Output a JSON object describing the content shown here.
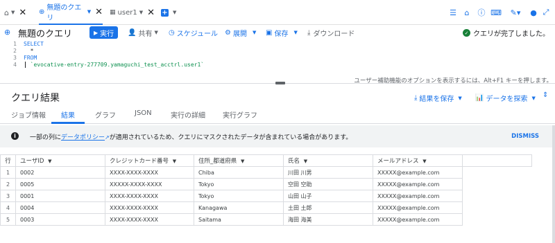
{
  "tabs": [
    {
      "label": "無題のクエリ",
      "active": true
    },
    {
      "label": "user1",
      "active": false
    }
  ],
  "query": {
    "title": "無題のクエリ",
    "run_label": "実行",
    "share_label": "共有",
    "schedule_label": "スケジュール",
    "deploy_label": "展開",
    "save_label": "保存",
    "download_label": "ダウンロード",
    "status": "クエリが完了しました。"
  },
  "editor": {
    "lines": [
      {
        "n": "1",
        "text": "SELECT"
      },
      {
        "n": "2",
        "text": "  *"
      },
      {
        "n": "3",
        "text": "FROM"
      },
      {
        "n": "4",
        "text": "  `evocative-entry-277709.yamaguchi_test_acctrl.user1`"
      }
    ],
    "a11y_hint": "ユーザー補助機能のオプションを表示するには、Alt+F1 キーを押します。"
  },
  "results": {
    "title": "クエリ結果",
    "save_results_label": "結果を保存",
    "explore_label": "データを探索",
    "subtabs": [
      "ジョブ情報",
      "結果",
      "グラフ",
      "JSON",
      "実行の詳細",
      "実行グラフ"
    ],
    "active_subtab": 1,
    "notice_prefix": "一部の列に",
    "notice_link": "データポリシー",
    "notice_suffix": "が適用されているため、クエリにマスクされたデータが含まれている場合があります。",
    "dismiss_label": "DISMISS",
    "columns": [
      "行",
      "ユーザID",
      "クレジットカード番号",
      "住所_都道府県",
      "氏名",
      "メールアドレス"
    ],
    "rows": [
      [
        "1",
        "0002",
        "XXXX-XXXX-XXXX",
        "Chiba",
        "川田 川男",
        "XXXXX@example.com"
      ],
      [
        "2",
        "0005",
        "XXXXX-XXXX-XXXX",
        "Tokyo",
        "空田 空助",
        "XXXXX@example.com"
      ],
      [
        "3",
        "0001",
        "XXXX-XXXX-XXXX",
        "Tokyo",
        "山田 山子",
        "XXXXX@example.com"
      ],
      [
        "4",
        "0004",
        "XXXX-XXXX-XXXX",
        "Kanagawa",
        "土田 土郎",
        "XXXXX@example.com"
      ],
      [
        "5",
        "0003",
        "XXXX-XXXX-XXXX",
        "Saitama",
        "海田 海美",
        "XXXXX@example.com"
      ]
    ]
  },
  "colors": {
    "accent": "#1a73e8",
    "success": "#188038",
    "notice_bg": "#f1f3f4"
  }
}
